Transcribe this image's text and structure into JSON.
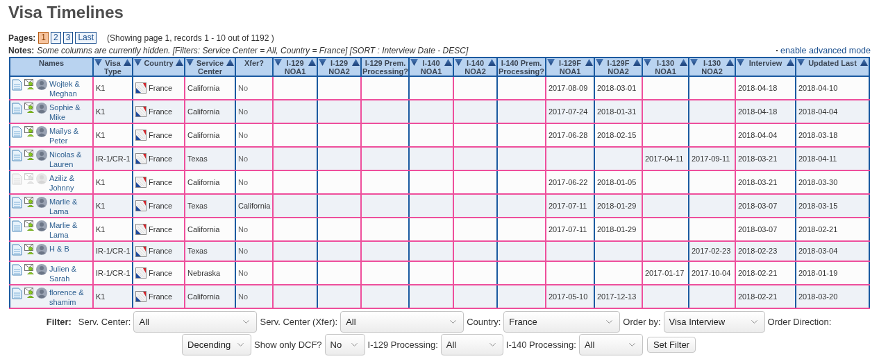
{
  "title": "Visa Timelines",
  "pages": {
    "label": "Pages:",
    "items": [
      {
        "label": "1",
        "selected": true
      },
      {
        "label": "2",
        "selected": false
      },
      {
        "label": "3",
        "selected": false
      },
      {
        "label": "Last",
        "selected": false
      }
    ],
    "summary": "(Showing page 1, records 1 - 10 out of 1192 )"
  },
  "notes": {
    "label": "Notes:",
    "text": "Some columns are currently hidden. [Filters: Service Center = All, Country = France] [SORT : Interview Date - DESC]",
    "link": "enable advanced mode"
  },
  "table": {
    "columns": [
      {
        "label": "Names",
        "sortable": false
      },
      {
        "label": "Visa Type",
        "sortable": true
      },
      {
        "label": "Country",
        "sortable": true
      },
      {
        "label": "Service Center",
        "sortable": true
      },
      {
        "label": "Xfer?",
        "sortable": false
      },
      {
        "label": "I-129 NOA1",
        "sortable": true
      },
      {
        "label": "I-129 NOA2",
        "sortable": true
      },
      {
        "label": "I-129 Prem. Processing?",
        "sortable": false
      },
      {
        "label": "I-140 NOA1",
        "sortable": true
      },
      {
        "label": "I-140 NOA2",
        "sortable": true
      },
      {
        "label": "I-140 Prem. Processing?",
        "sortable": false
      },
      {
        "label": "I-129F NOA1",
        "sortable": true
      },
      {
        "label": "I-129F NOA2",
        "sortable": true
      },
      {
        "label": "I-130 NOA1",
        "sortable": true
      },
      {
        "label": "I-130 NOA2",
        "sortable": true
      },
      {
        "label": "Interview",
        "sortable": true
      },
      {
        "label": "Updated Last",
        "sortable": true
      }
    ],
    "rows": [
      {
        "active": true,
        "cells": [
          "Wojtek & Meghan",
          "K1",
          "France",
          "California",
          "No",
          "",
          "",
          "",
          "",
          "",
          "",
          "2017-08-09",
          "2018-03-01",
          "",
          "",
          "2018-04-18",
          "2018-04-10"
        ]
      },
      {
        "active": true,
        "cells": [
          "Sophie & Mike",
          "K1",
          "France",
          "California",
          "No",
          "",
          "",
          "",
          "",
          "",
          "",
          "2017-07-24",
          "2018-01-31",
          "",
          "",
          "2018-04-18",
          "2018-04-04"
        ]
      },
      {
        "active": true,
        "cells": [
          "Maïlys & Peter",
          "K1",
          "France",
          "California",
          "No",
          "",
          "",
          "",
          "",
          "",
          "",
          "2017-06-28",
          "2018-02-15",
          "",
          "",
          "2018-04-04",
          "2018-03-18"
        ]
      },
      {
        "active": true,
        "cells": [
          "Nicolas & Lauren",
          "IR-1/CR-1",
          "France",
          "Texas",
          "No",
          "",
          "",
          "",
          "",
          "",
          "",
          "",
          "",
          "2017-04-11",
          "2017-09-11",
          "2018-03-21",
          "2018-04-11"
        ]
      },
      {
        "active": false,
        "cells": [
          "Aziliz & Johnny",
          "K1",
          "France",
          "California",
          "No",
          "",
          "",
          "",
          "",
          "",
          "",
          "2017-06-22",
          "2018-01-05",
          "",
          "",
          "2018-03-21",
          "2018-03-30"
        ]
      },
      {
        "active": true,
        "cells": [
          "Marlie & Lama",
          "K1",
          "France",
          "Texas",
          "California",
          "",
          "",
          "",
          "",
          "",
          "",
          "2017-07-11",
          "2018-01-29",
          "",
          "",
          "2018-03-07",
          "2018-03-15"
        ]
      },
      {
        "active": true,
        "cells": [
          "Marlie & Lama",
          "K1",
          "France",
          "California",
          "No",
          "",
          "",
          "",
          "",
          "",
          "",
          "2017-07-11",
          "2018-01-29",
          "",
          "",
          "2018-03-07",
          "2018-02-21"
        ]
      },
      {
        "active": true,
        "cells": [
          "H & B",
          "IR-1/CR-1",
          "France",
          "Texas",
          "No",
          "",
          "",
          "",
          "",
          "",
          "",
          "",
          "",
          "",
          "2017-02-23",
          "2018-02-23",
          "2018-03-04"
        ]
      },
      {
        "active": true,
        "cells": [
          "Julien & Sarah",
          "IR-1/CR-1",
          "France",
          "Nebraska",
          "No",
          "",
          "",
          "",
          "",
          "",
          "",
          "",
          "",
          "2017-01-17",
          "2017-10-04",
          "2018-02-21",
          "2018-01-19"
        ]
      },
      {
        "active": true,
        "cells": [
          "florence & shamim",
          "K1",
          "France",
          "California",
          "No",
          "",
          "",
          "",
          "",
          "",
          "",
          "2017-05-10",
          "2017-12-13",
          "",
          "",
          "2018-02-21",
          "2018-03-20"
        ]
      }
    ]
  },
  "filter": {
    "label": "Filter:",
    "items": [
      {
        "kind": "label",
        "text": "Serv. Center:"
      },
      {
        "kind": "select",
        "value": "All"
      },
      {
        "kind": "label",
        "text": "Serv. Center (Xfer):"
      },
      {
        "kind": "select",
        "value": "All"
      },
      {
        "kind": "label",
        "text": "Country:"
      },
      {
        "kind": "select",
        "value": "France"
      },
      {
        "kind": "label",
        "text": "Order by:"
      },
      {
        "kind": "select",
        "value": "Visa Interview"
      },
      {
        "kind": "label",
        "text": "Order Direction:"
      },
      {
        "kind": "select",
        "value": "Decending"
      },
      {
        "kind": "label",
        "text": "Show only DCF?"
      },
      {
        "kind": "select",
        "value": "No"
      },
      {
        "kind": "label",
        "text": "I-129 Processing:"
      },
      {
        "kind": "select",
        "value": "All"
      },
      {
        "kind": "label",
        "text": "I-140 Processing:"
      },
      {
        "kind": "select",
        "value": "All"
      }
    ],
    "button": "Set Filter"
  }
}
